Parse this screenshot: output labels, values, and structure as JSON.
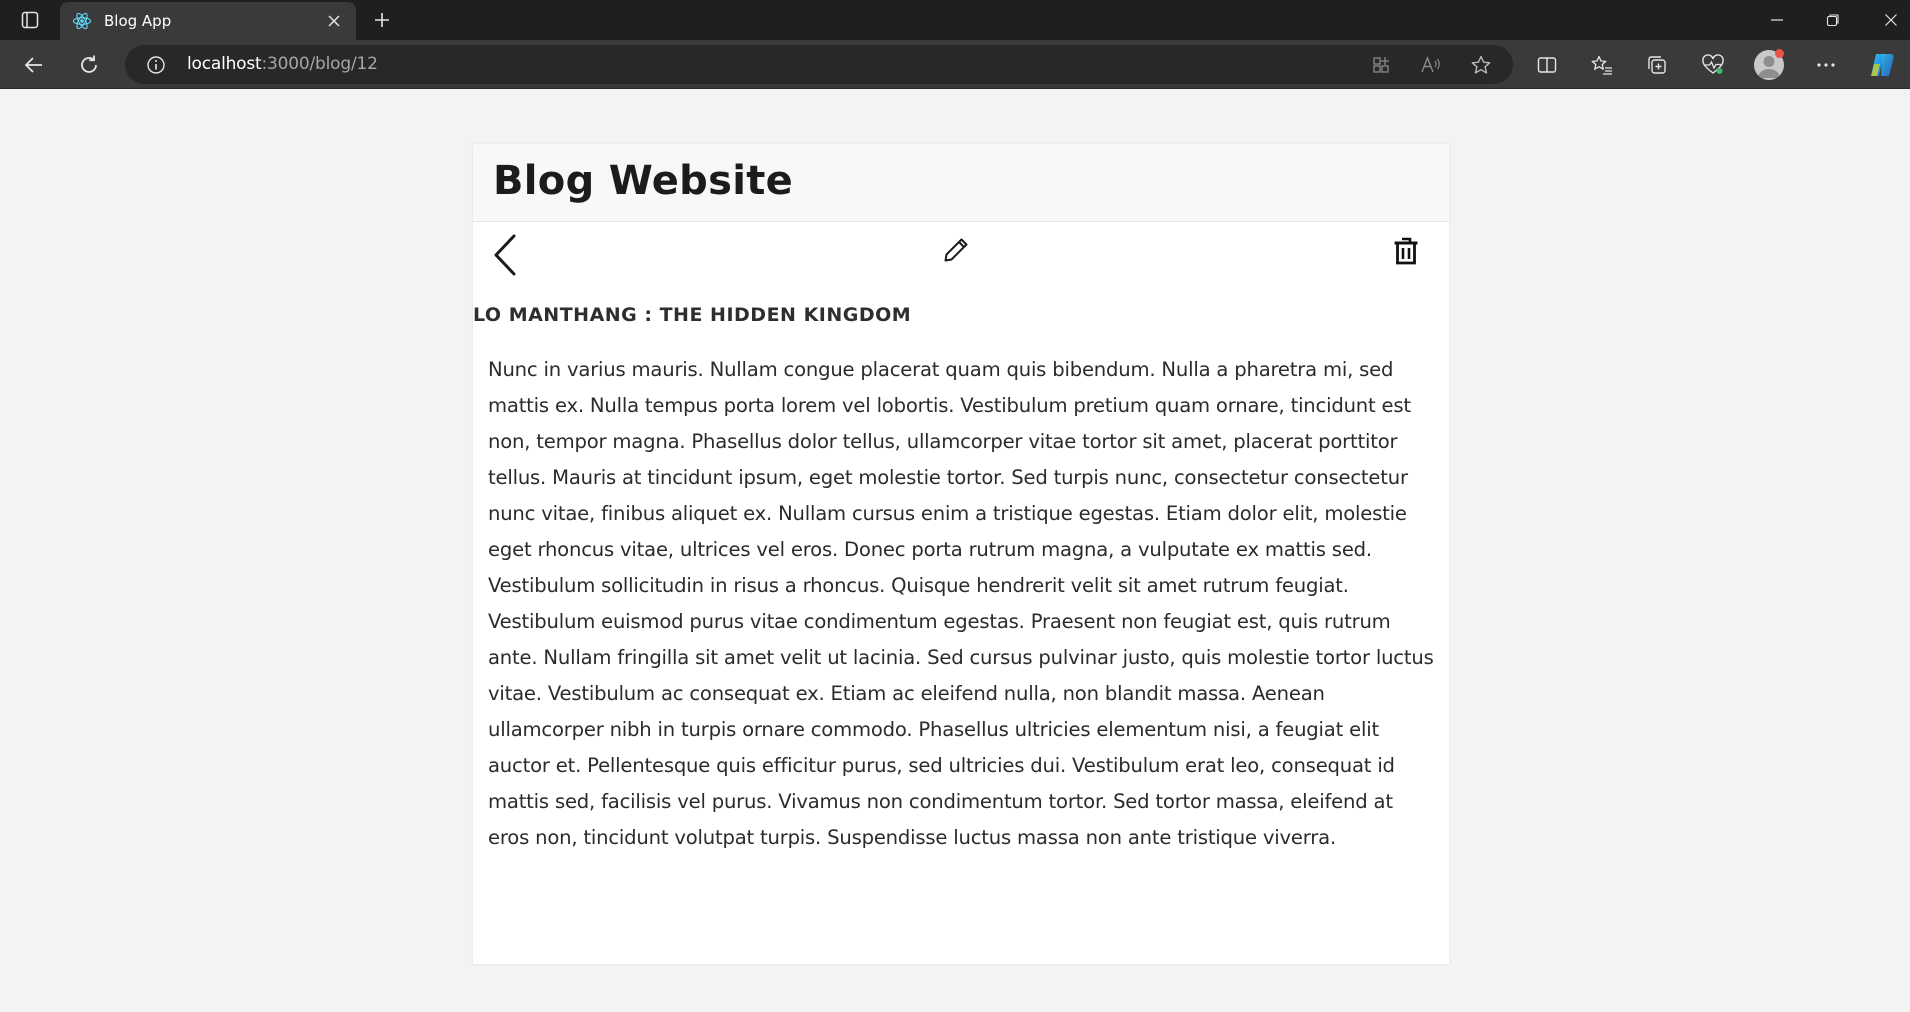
{
  "browser": {
    "tab": {
      "title": "Blog App",
      "favicon": "react-icon"
    },
    "url": {
      "host": "localhost",
      "rest": ":3000/blog/12"
    },
    "icons": {
      "tab_actions": "tab-actions-icon",
      "close_tab": "close-icon",
      "new_tab": "plus-icon",
      "minimize": "minimize-icon",
      "restore": "restore-icon",
      "close_window": "close-icon",
      "back": "back-arrow-icon",
      "refresh": "refresh-icon",
      "site_info": "info-icon",
      "apps": "apps-icon",
      "read_aloud": "read-aloud-icon",
      "favorite": "star-icon",
      "split_screen": "split-screen-icon",
      "favorites": "favorites-icon",
      "collections": "collections-icon",
      "browser_essentials": "heartbeat-icon",
      "profile": "avatar",
      "more": "more-icon",
      "copilot": "copilot-icon"
    }
  },
  "page": {
    "site_title": "Blog Website",
    "actions": {
      "back": "back-chevron-icon",
      "edit": "pencil-icon",
      "delete": "trash-icon"
    },
    "post": {
      "title": "LO MANTHANG : THE HIDDEN KINGDOM",
      "body": "Nunc in varius mauris. Nullam congue placerat quam quis bibendum. Nulla a pharetra mi, sed mattis ex. Nulla tempus porta lorem vel lobortis. Vestibulum pretium quam ornare, tincidunt est non, tempor magna. Phasellus dolor tellus, ullamcorper vitae tortor sit amet, placerat porttitor tellus. Mauris at tincidunt ipsum, eget molestie tortor. Sed turpis nunc, consectetur consectetur nunc vitae, finibus aliquet ex. Nullam cursus enim a tristique egestas. Etiam dolor elit, molestie eget rhoncus vitae, ultrices vel eros. Donec porta rutrum magna, a vulputate ex mattis sed. Vestibulum sollicitudin in risus a rhoncus. Quisque hendrerit velit sit amet rutrum feugiat. Vestibulum euismod purus vitae condimentum egestas. Praesent non feugiat est, quis rutrum ante. Nullam fringilla sit amet velit ut lacinia. Sed cursus pulvinar justo, quis molestie tortor luctus vitae. Vestibulum ac consequat ex. Etiam ac eleifend nulla, non blandit massa. Aenean ullamcorper nibh in turpis ornare commodo. Phasellus ultricies elementum nisi, a feugiat elit auctor et. Pellentesque quis efficitur purus, sed ultricies dui. Vestibulum erat leo, consequat id mattis sed, facilisis vel purus. Vivamus non condimentum tortor. Sed tortor massa, eleifend at eros non, tincidunt volutpat turpis. Suspendisse luctus massa non ante tristique viverra."
    }
  },
  "colors": {
    "chrome_dark": "#1f1f1f",
    "chrome_toolbar": "#3a3a3a",
    "page_bg": "#f3f3f3",
    "card_bg": "#ffffff",
    "header_bg": "#f8f8f8",
    "text": "#2b2b2b"
  }
}
